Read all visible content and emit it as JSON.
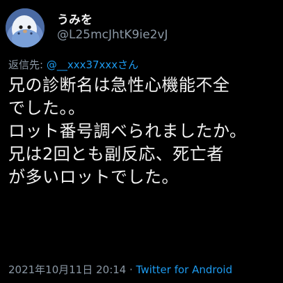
{
  "author": {
    "display_name": "うみを",
    "handle": "@L25mcJhtK9ie2vJ",
    "avatar_icon": "budgie-avatar-icon"
  },
  "reply": {
    "prefix": "返信先: ",
    "mention": "@__xxx37xxxさん"
  },
  "tweet": {
    "text": "兄の診断名は急性心機能不全\nでした。。\nロット番号調べられましたか。\n兄は2回とも副反応、死亡者\nが多いロットでした。"
  },
  "meta": {
    "timestamp": "2021年10月11日 20:14",
    "separator": " · ",
    "source": "Twitter for Android"
  },
  "colors": {
    "background": "#000000",
    "text": "#f2f2f2",
    "secondary": "#8b98a5",
    "accent": "#1d9bf0"
  }
}
